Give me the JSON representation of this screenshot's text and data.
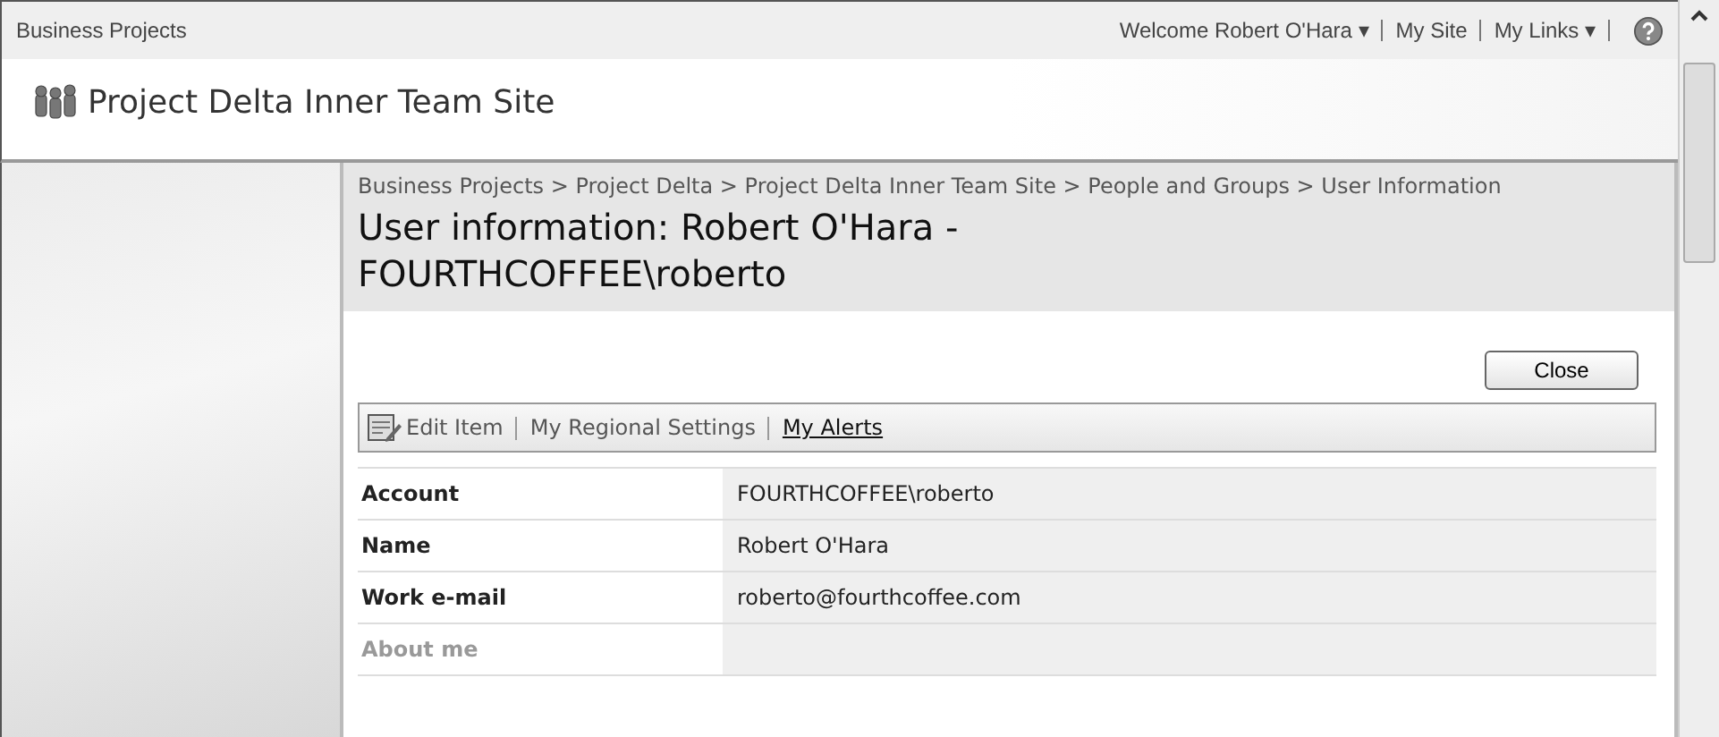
{
  "top_bar": {
    "site_link": "Business Projects",
    "welcome": "Welcome Robert O'Hara ▾",
    "links": [
      "My Site",
      "My Links ▾"
    ]
  },
  "site_title": "Project Delta Inner Team Site",
  "breadcrumb": "Business Projects > Project Delta > Project Delta Inner Team Site > People and Groups > User Information",
  "page_title": "User information: Robert O'Hara - FOURTHCOFFEE\\roberto",
  "close_button": "Close",
  "toolbar": [
    {
      "label": "Edit Item",
      "kind": "icon",
      "underlined": false
    },
    {
      "label": "My Regional Settings",
      "kind": "plain",
      "underlined": false
    },
    {
      "label": "My Alerts",
      "kind": "plain",
      "underlined": true
    }
  ],
  "fields": [
    {
      "label": "Account",
      "value": "FOURTHCOFFEE\\roberto",
      "dimmed": false
    },
    {
      "label": "Name",
      "value": "Robert O'Hara",
      "dimmed": false
    },
    {
      "label": "Work e-mail",
      "value": "roberto@fourthcoffee.com",
      "dimmed": false
    },
    {
      "label": "About me",
      "dimmed": true
    }
  ]
}
